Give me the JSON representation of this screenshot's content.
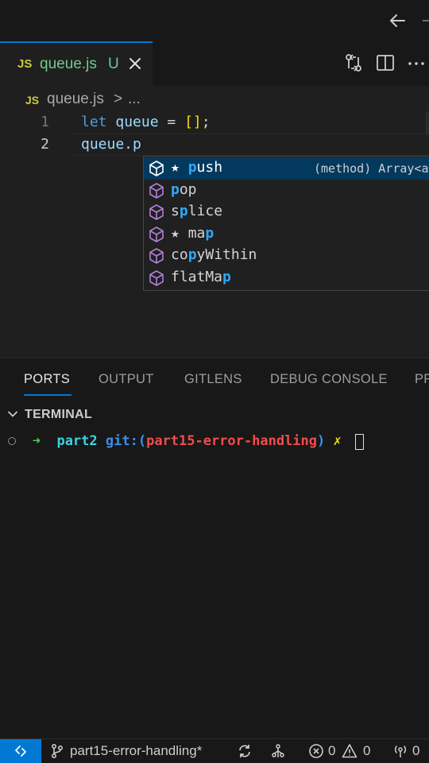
{
  "tab": {
    "icon_text": "JS",
    "file_name": "queue.js",
    "status": "U"
  },
  "breadcrumb": {
    "icon_text": "JS",
    "file_name": "queue.js",
    "separator": ">",
    "more": "..."
  },
  "editor": {
    "line_numbers": [
      "1",
      "2"
    ],
    "line1": {
      "kw": "let",
      "name": "queue",
      "eq": " = ",
      "brackets": "[]",
      "semi": ";"
    },
    "line2": {
      "text": "queue.p"
    }
  },
  "suggest": {
    "items": [
      {
        "star": "★ ",
        "match": "p",
        "rest": "ush",
        "detail": "(method) Array<a",
        "selected": true
      },
      {
        "star": "",
        "match": "p",
        "rest": "op"
      },
      {
        "star": "",
        "pre": "s",
        "match": "p",
        "rest": "lice"
      },
      {
        "star": "★ ",
        "pre": "ma",
        "match": "p",
        "rest": ""
      },
      {
        "star": "",
        "pre": "co",
        "match": "p",
        "rest": "yWithin"
      },
      {
        "star": "",
        "pre": "flatMa",
        "match": "p",
        "rest": ""
      }
    ]
  },
  "panel": {
    "tabs": [
      "PORTS",
      "OUTPUT",
      "GITLENS",
      "DEBUG CONSOLE",
      "PR"
    ],
    "active_tab": "PORTS",
    "section_title": "TERMINAL",
    "prompt": {
      "arrow": "➜",
      "dir": "part2",
      "git_label": "git:(",
      "branch": "part15-error-handling",
      "git_close": ")",
      "dirty": "✗"
    }
  },
  "statusbar": {
    "branch": "part15-error-handling*",
    "errors": "0",
    "warnings": "0",
    "ports": "0"
  },
  "colors": {
    "accent": "#0078d4",
    "match_highlight": "#2aaaff",
    "selected_row": "#04395e",
    "cube_icon": "#b180d7"
  }
}
